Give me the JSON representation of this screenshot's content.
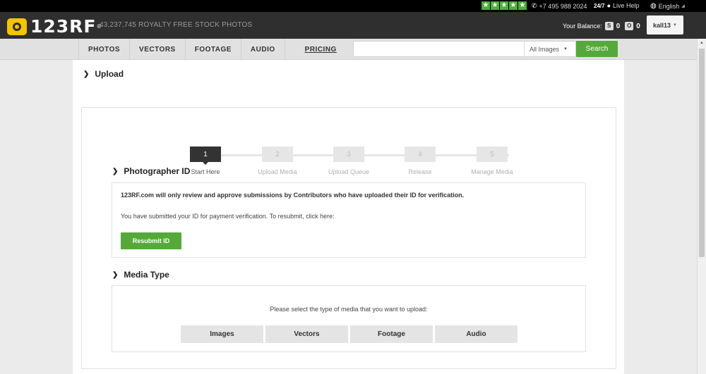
{
  "topbar": {
    "rating_stars": 5,
    "phone": "+7 495 988 2024",
    "support_hours": "24/7",
    "live_help": "Live Help",
    "language": "English"
  },
  "header": {
    "logo_text": "123RF",
    "logo_mark": "®",
    "tagline": "43,237,745  ROYALTY FREE STOCK PHOTOS",
    "balance_label": "Your Balance:",
    "balance_credits_icon": "S",
    "balance_credits": "0",
    "balance_subs_icon": "O",
    "balance_subs": "0",
    "username": "kall13"
  },
  "nav": {
    "items": [
      "PHOTOS",
      "VECTORS",
      "FOOTAGE",
      "AUDIO"
    ],
    "pricing": "PRICING",
    "search_placeholder": "",
    "search_scope": "All Images",
    "search_button": "Search"
  },
  "page": {
    "title": "Upload",
    "steps": [
      {
        "number": "1",
        "label": "Start Here",
        "active": true
      },
      {
        "number": "2",
        "label": "Upload Media",
        "active": false
      },
      {
        "number": "3",
        "label": "Upload Queue",
        "active": false
      },
      {
        "number": "4",
        "label": "Release",
        "active": false
      },
      {
        "number": "5",
        "label": "Manage Media",
        "active": false
      }
    ],
    "photographer_id": {
      "title": "Photographer ID",
      "notice": "123RF.com will only review and approve submissions by Contributors who have uploaded their ID for verification.",
      "status": "You have submitted your ID for payment verification. To resubmit, click here:",
      "button": "Resubmit ID"
    },
    "media_type": {
      "title": "Media Type",
      "prompt": "Please select the type of media that you want to upload:",
      "options": [
        "Images",
        "Vectors",
        "Footage",
        "Audio"
      ]
    }
  },
  "colors": {
    "accent_green": "#55a93a",
    "header_dark": "#2f2f2f",
    "logo_yellow": "#f5c400"
  }
}
